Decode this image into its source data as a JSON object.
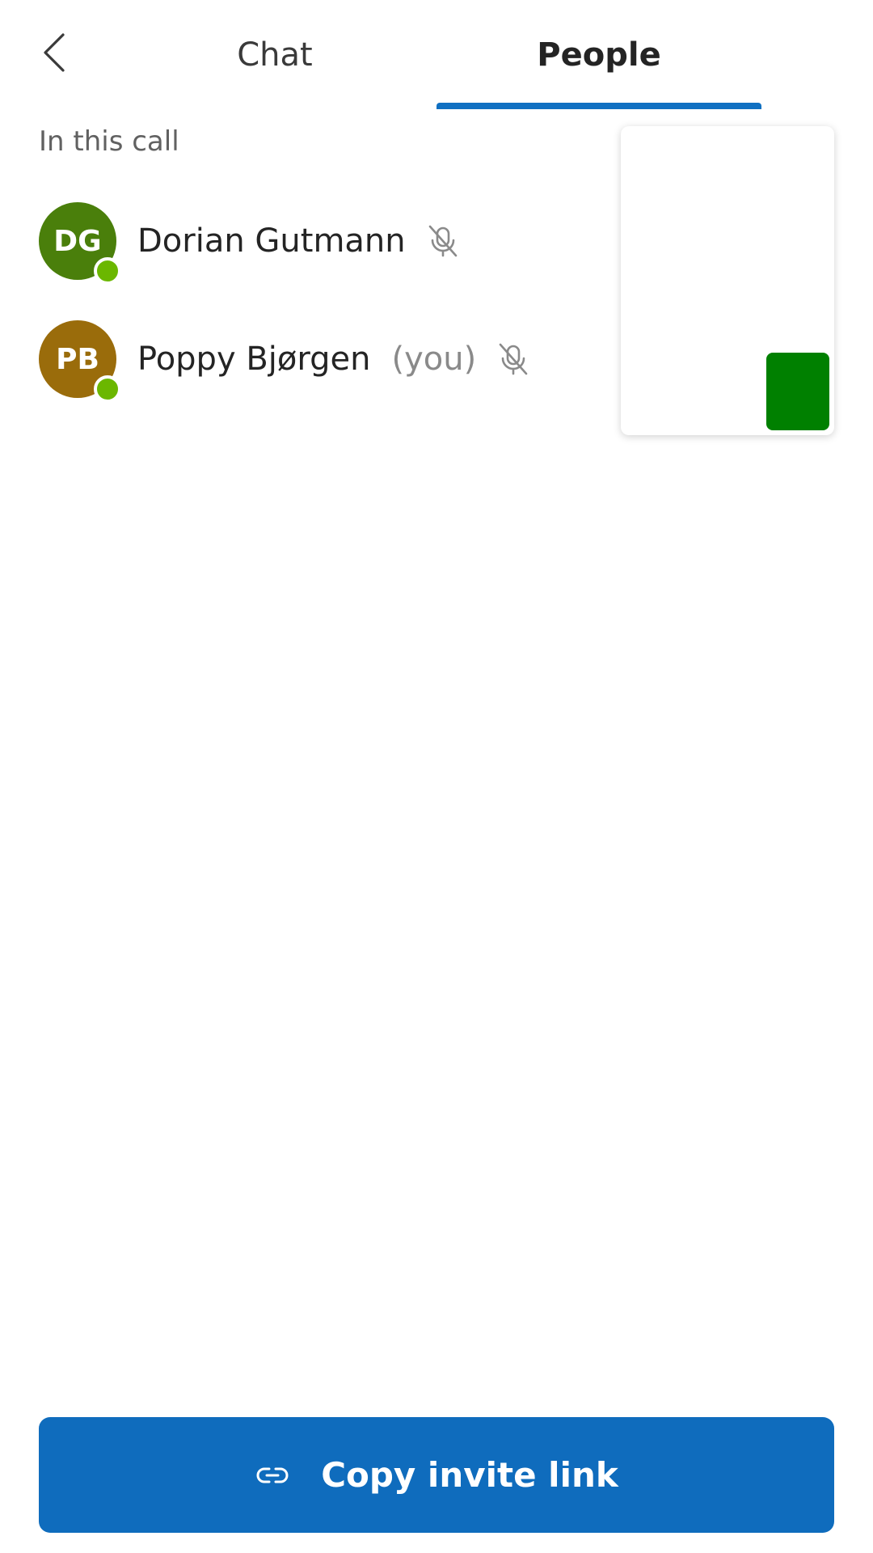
{
  "header": {
    "tabs": [
      {
        "label": "Chat",
        "selected": false
      },
      {
        "label": "People",
        "selected": true
      }
    ]
  },
  "section": {
    "label": "In this call"
  },
  "participants": [
    {
      "initials": "DG",
      "name": "Dorian Gutmann",
      "you_label": "",
      "avatar_color": "#4a7f0b",
      "presence_color": "#6bb700",
      "muted": true,
      "icon": "mic-off-icon"
    },
    {
      "initials": "PB",
      "name": "Poppy Bjørgen",
      "you_label": "(you)",
      "avatar_color": "#9a6c0b",
      "presence_color": "#6bb700",
      "muted": true,
      "icon": "mic-off-icon"
    }
  ],
  "video_preview": {
    "tile_color": "#008000"
  },
  "invite": {
    "label": "Copy invite link",
    "icon": "link-icon",
    "color": "#0f6cbd"
  },
  "colors": {
    "accent": "#1070c2"
  }
}
